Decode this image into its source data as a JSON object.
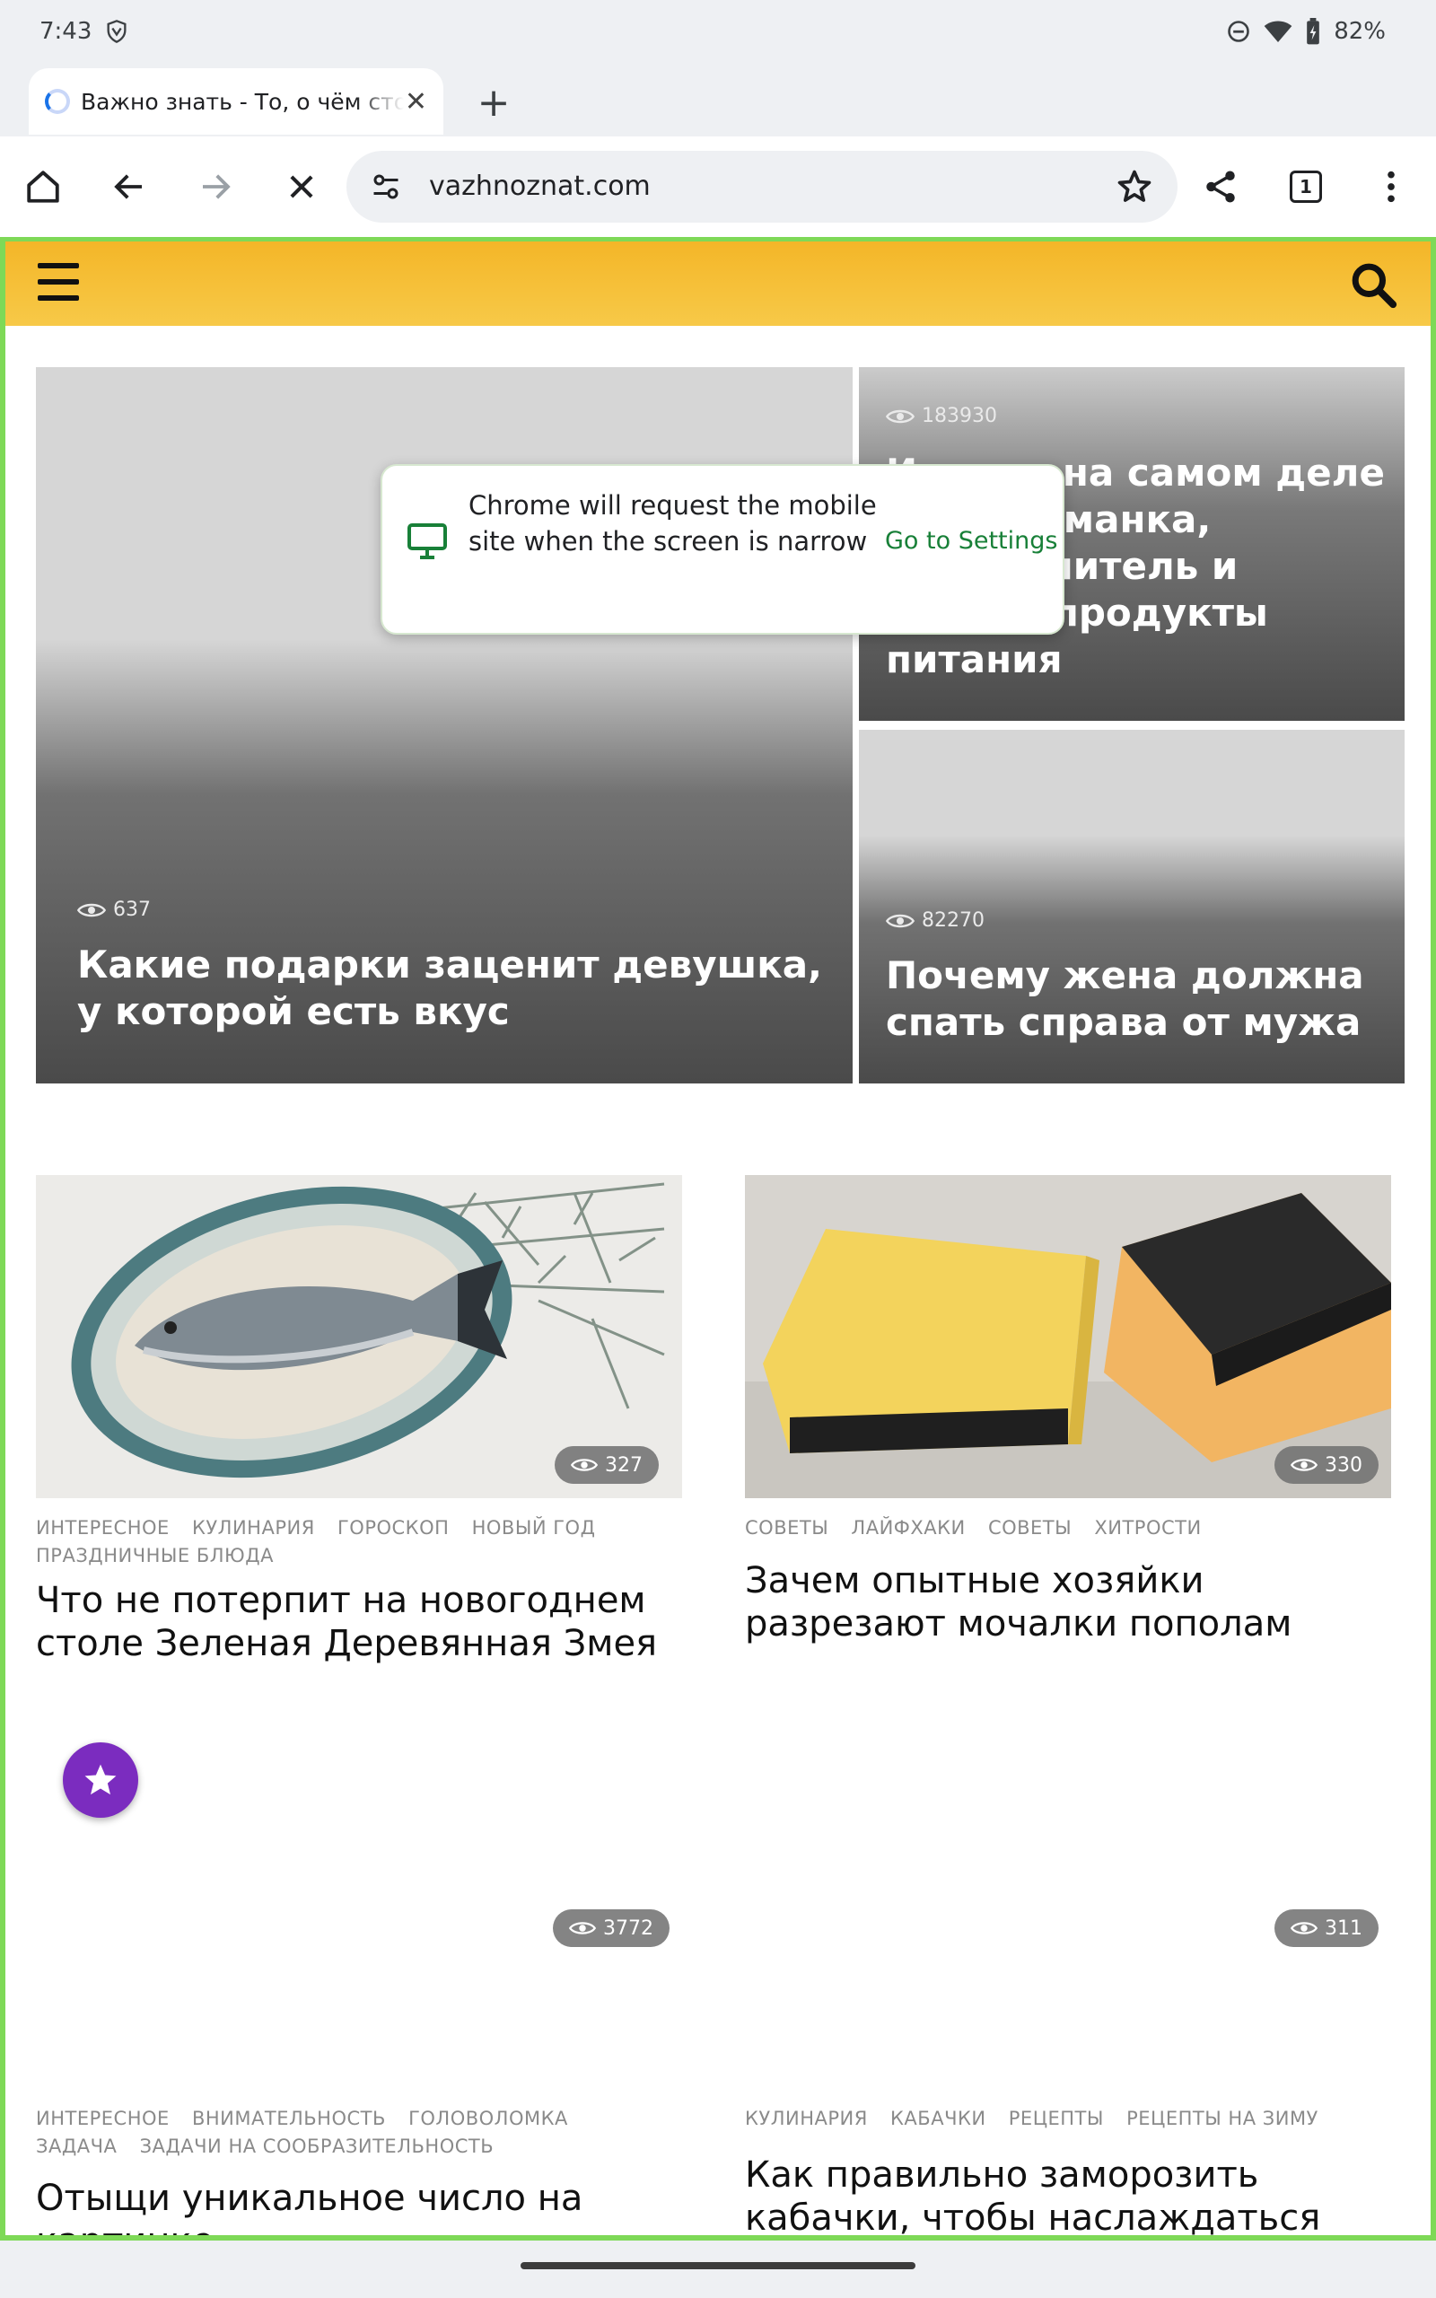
{
  "status_bar": {
    "time": "7:43",
    "battery": "82%"
  },
  "tab": {
    "title": "Важно знать - То, о чём стоит знать"
  },
  "omnibox": {
    "url": "vazhnoznat.com"
  },
  "toolbar": {
    "tab_count": "1"
  },
  "popup": {
    "message": "Chrome will request the mobile site when the screen is narrow",
    "action": "Go to Settings"
  },
  "hero": [
    {
      "views": "637",
      "title": "Какие подарки заценит девушка, у которой есть вкус"
    },
    {
      "views": "183930",
      "title": "Из чего на самом деле состоят манка, разрыхлитель и другие продукты питания"
    },
    {
      "views": "82270",
      "title": "Почему жена должна спать справа от мужа"
    }
  ],
  "cards": [
    {
      "views": "327",
      "tags": [
        "ИНТЕРЕСНОЕ",
        "КУЛИНАРИЯ",
        "ГОРОСКОП",
        "НОВЫЙ ГОД",
        "ПРАЗДНИЧНЫЕ БЛЮДА"
      ],
      "title": "Что не потерпит на новогоднем столе Зеленая Деревянная Змея"
    },
    {
      "views": "330",
      "tags": [
        "СОВЕТЫ",
        "ЛАЙФХАКИ",
        "СОВЕТЫ",
        "ХИТРОСТИ"
      ],
      "title": "Зачем опытные хозяйки разрезают мочалки пополам"
    },
    {
      "views": "3772",
      "tags": [
        "ИНТЕРЕСНОЕ",
        "ВНИМАТЕЛЬНОСТЬ",
        "ГОЛОВОЛОМКА",
        "ЗАДАЧА",
        "ЗАДАЧИ НА СООБРАЗИТЕЛЬНОСТЬ"
      ],
      "title": "Отыщи уникальное число на картинке"
    },
    {
      "views": "311",
      "tags": [
        "КУЛИНАРИЯ",
        "КАБАЧКИ",
        "РЕЦЕПТЫ",
        "РЕЦЕПТЫ НА ЗИМУ"
      ],
      "title": "Как правильно заморозить кабачки, чтобы наслаждаться"
    }
  ],
  "colors": {
    "site_header": "#f4b628",
    "frame_border": "#7ed957",
    "fab": "#7b2cbf",
    "popup_action": "#188038"
  }
}
